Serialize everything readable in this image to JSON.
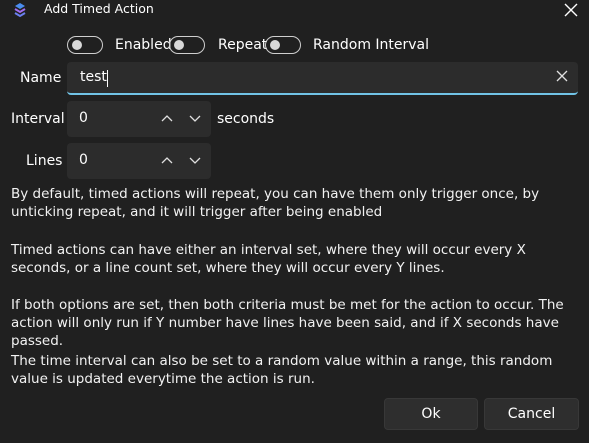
{
  "window": {
    "title": "Add Timed Action"
  },
  "toggles": {
    "enabled": {
      "label": "Enabled",
      "on": false
    },
    "repeat": {
      "label": "Repeat",
      "on": false
    },
    "random_interval": {
      "label": "Random Interval",
      "on": false
    }
  },
  "form": {
    "name_label": "Name",
    "name_value": "test",
    "interval_label": "Interval",
    "interval_value": "0",
    "interval_units": "seconds",
    "lines_label": "Lines",
    "lines_value": "0"
  },
  "help": [
    "By default, timed actions will repeat, you can have them only trigger once, by unticking repeat, and it will trigger after being enabled",
    "Timed actions can have either an interval set, where they will occur every X seconds, or a line count set, where they will occur every Y lines.",
    "If both options are set, then both criteria must be met for the action to occur. The action will only run if Y number have lines have been said, and if X seconds have passed.",
    "The time interval can also be set to a random value within a range, this random value is updated everytime the action is run."
  ],
  "buttons": {
    "ok": "Ok",
    "cancel": "Cancel"
  },
  "icons": {
    "app": "app-logo-icon",
    "close": "close-icon",
    "clear": "clear-icon",
    "up": "chevron-up-icon",
    "down": "chevron-down-icon"
  },
  "colors": {
    "background": "#202020",
    "input_background": "#2c2c2c",
    "accent": "#71c3e6",
    "logo_blue": "#4a8df0",
    "logo_purple": "#a26df0"
  }
}
